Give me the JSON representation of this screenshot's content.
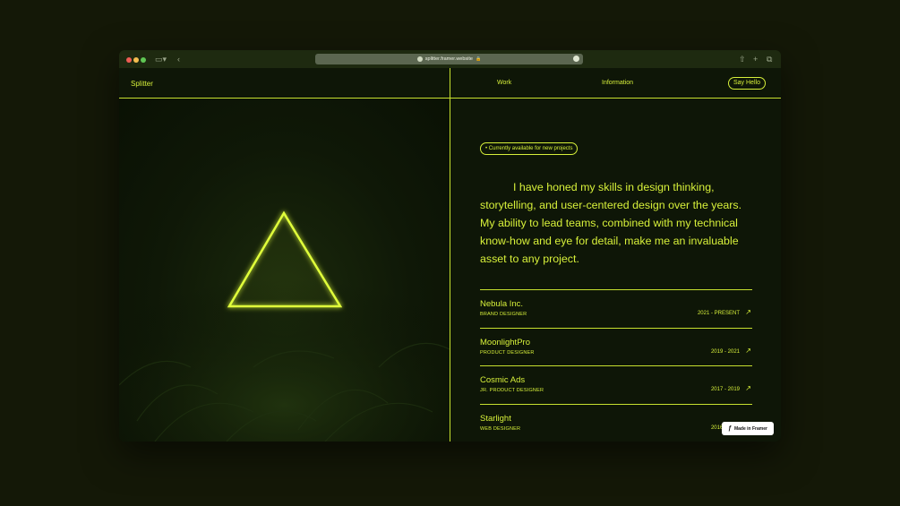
{
  "browser": {
    "url": "splitter.framer.website",
    "icons": {
      "sidebar": "sidebar-icon",
      "back": "chevron-left-icon",
      "lock": "lock-icon",
      "share": "share-icon",
      "new_tab": "plus-icon",
      "tabs": "tabs-icon"
    }
  },
  "nav": {
    "brand": "Splitter",
    "work": "Work",
    "information": "Information",
    "say_hello": "Say Hello"
  },
  "availability": "• Currently available for new projects",
  "intro": "I have honed my skills in design thinking, storytelling, and user-centered design over the years. My ability to lead teams, combined with my technical know-how and eye for detail, make me an invaluable asset to any project.",
  "jobs": [
    {
      "company": "Nebula Inc.",
      "role": "BRAND DESIGNER",
      "years": "2021 - PRESENT"
    },
    {
      "company": "MoonlightPro",
      "role": "PRODUCT DESIGNER",
      "years": "2019 - 2021"
    },
    {
      "company": "Cosmic Ads",
      "role": "JR. PRODUCT DESIGNER",
      "years": "2017 - 2019"
    },
    {
      "company": "Starlight",
      "role": "WEB DESIGNER",
      "years": "2016 - 2017"
    }
  ],
  "badge": "Made in Framer",
  "colors": {
    "accent": "#d7f03a",
    "background": "#0e1607",
    "outer": "#141807"
  }
}
